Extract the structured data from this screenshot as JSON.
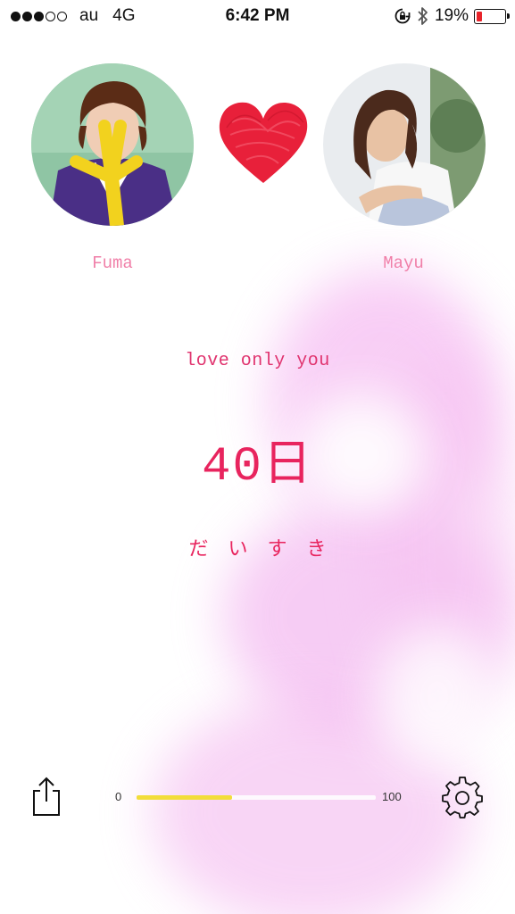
{
  "status_bar": {
    "carrier": "au",
    "network": "4G",
    "time": "6:42 PM",
    "battery_percent": "19%",
    "signal_bars_filled": 3,
    "signal_bars_total": 5,
    "battery_level": 0.19
  },
  "couple": {
    "left_name": "Fuma",
    "right_name": "Mayu"
  },
  "tagline": "love only you",
  "day_count": "40日",
  "message": "だいすき",
  "progress": {
    "min_label": "0",
    "max_label": "100",
    "value": 40
  },
  "colors": {
    "accent": "#e8245e",
    "name_color": "#f07fa8",
    "progress_fill": "#f2dd3a",
    "heart": "#e8203a"
  }
}
